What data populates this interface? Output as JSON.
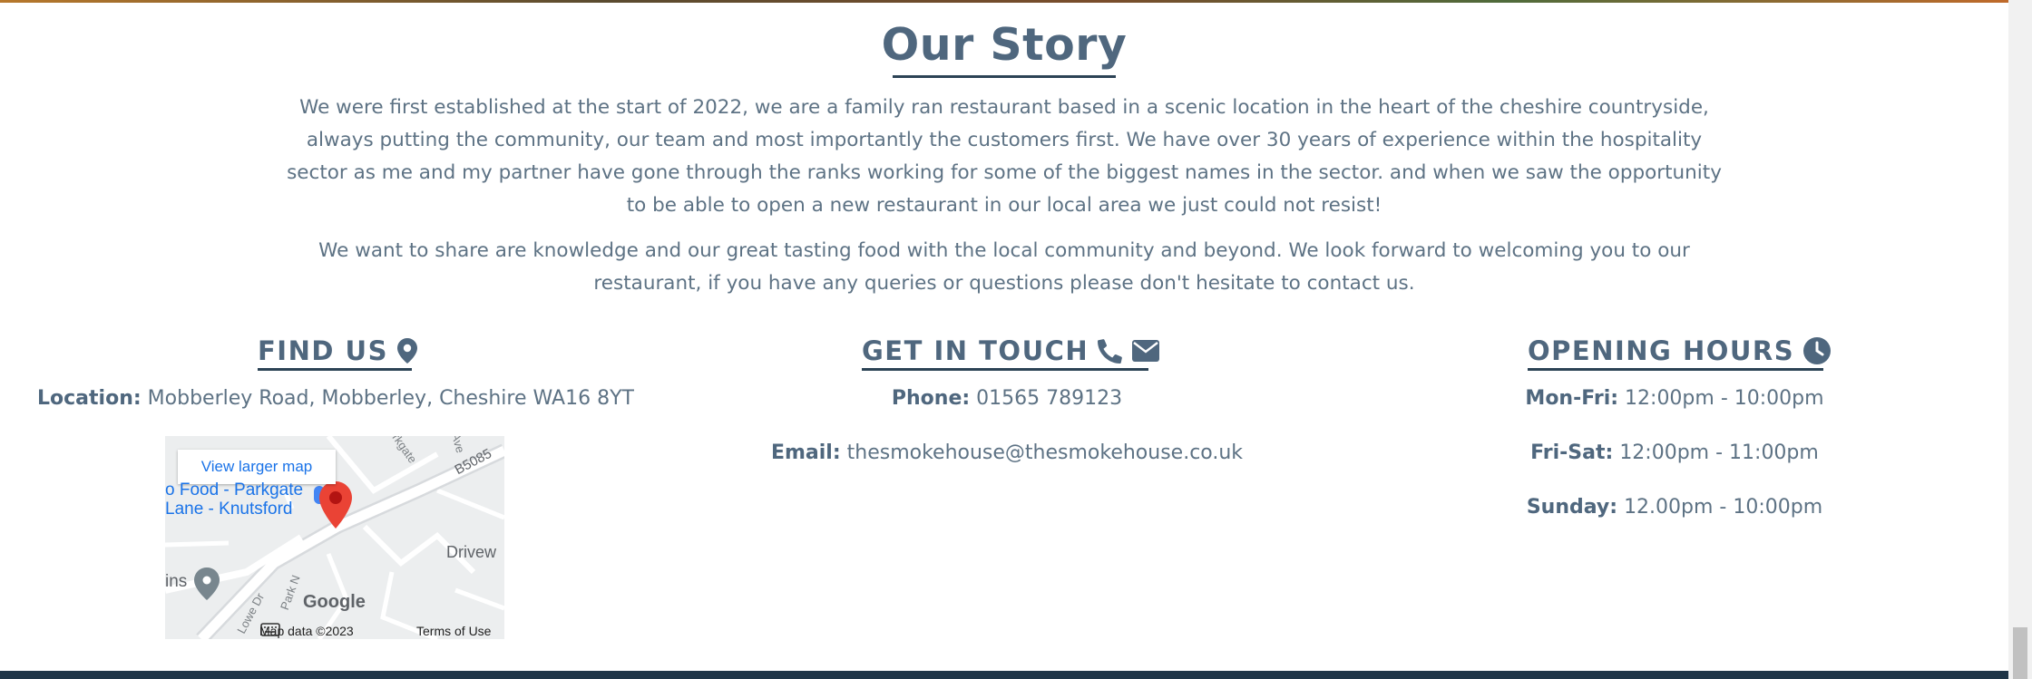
{
  "story": {
    "title": "Our Story",
    "paragraph_1": "We were first established at the start of 2022, we are a family ran restaurant based in a scenic location in the heart of the cheshire countryside, always putting the community, our team and most importantly the customers first. We have over 30 years of experience within the hospitality sector as me and my partner have gone through the ranks working for some of the biggest names in the sector. and when we saw the opportunity to be able to open a new restaurant in our local area we just could not resist!",
    "paragraph_2": "We want to share are knowledge and our great tasting food with the local community and beyond. We look forward to welcoming you to our restaurant, if you have any queries or questions please don't hesitate to contact us."
  },
  "find_us": {
    "heading": "FIND US",
    "location_label": "Location:",
    "location_value": "Mobberley Road, Mobberley, Cheshire WA16 8YT",
    "map": {
      "view_larger": "View larger map",
      "place_label_1": "o Food - Parkgate",
      "place_label_2": "Lane - Knutsford",
      "road_b5085": "B5085",
      "road_parkgate": "rkgate",
      "road_ave": "Ave",
      "road_drivew": "Drivew",
      "road_lowe": "Lowe Dr",
      "road_park": "Park N",
      "place_ins": "ins",
      "google_logo": "Google",
      "map_data": "Map data ©2023",
      "terms": "Terms of Use"
    }
  },
  "get_in_touch": {
    "heading": "GET IN TOUCH",
    "phone_label": "Phone:",
    "phone_value": "01565 789123",
    "email_label": "Email:",
    "email_value": "thesmokehouse@thesmokehouse.co.uk"
  },
  "opening_hours": {
    "heading": "OPENING HOURS",
    "rows": [
      {
        "day": "Mon-Fri:",
        "hours": "12:00pm - 10:00pm"
      },
      {
        "day": "Fri-Sat:",
        "hours": "12:00pm - 11:00pm"
      },
      {
        "day": "Sunday:",
        "hours": "12.00pm - 10:00pm"
      }
    ]
  },
  "icons": {
    "find_us": "map-pin-icon",
    "phone": "phone-icon",
    "email": "envelope-icon",
    "hours": "clock-icon"
  },
  "colors": {
    "heading": "#4f677e",
    "body_text": "#5d7284",
    "underline": "#2c4355",
    "footer": "#1f3547",
    "map_pin": "#ea4335"
  }
}
